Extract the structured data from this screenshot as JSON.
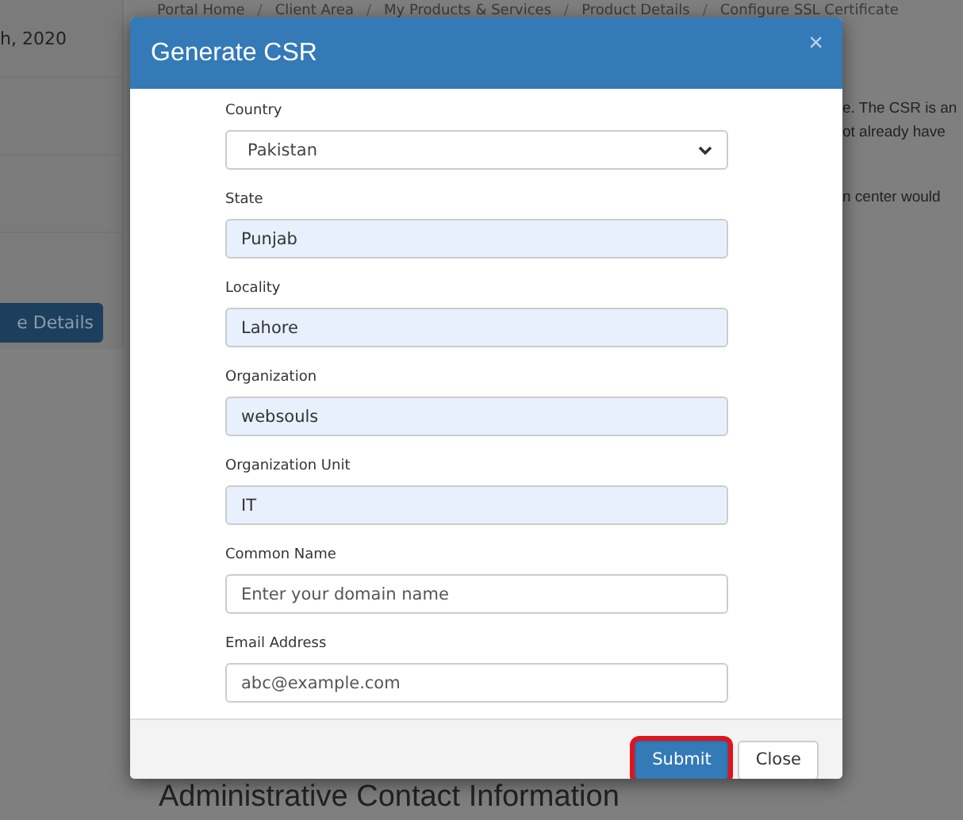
{
  "breadcrumb": [
    {
      "kind": "link",
      "text": "Portal Home"
    },
    {
      "kind": "separator",
      "text": "/"
    },
    {
      "kind": "link",
      "text": "Client Area"
    },
    {
      "kind": "separator",
      "text": "/"
    },
    {
      "kind": "link",
      "text": "My Products & Services"
    },
    {
      "kind": "separator",
      "text": "/"
    },
    {
      "kind": "link",
      "text": "Product Details"
    },
    {
      "kind": "separator",
      "text": "/"
    },
    {
      "kind": "link",
      "text": "Configure SSL Certificate"
    }
  ],
  "background": {
    "left_text": "h, 2020",
    "left_button": "e Details",
    "right_lines": [
      "e. The CSR is an",
      "ot already have",
      "n center would"
    ],
    "heading": "Administrative Contact Information"
  },
  "modal": {
    "title": "Generate CSR",
    "close": "×",
    "fields": [
      {
        "kind": "select",
        "label": "Country",
        "value": "Pakistan",
        "autofilled": false
      },
      {
        "kind": "input",
        "label": "State",
        "value": "Punjab",
        "autofilled": true
      },
      {
        "kind": "input",
        "label": "Locality",
        "value": "Lahore",
        "autofilled": true
      },
      {
        "kind": "input",
        "label": "Organization",
        "value": "websouls",
        "autofilled": true
      },
      {
        "kind": "input",
        "label": "Organization Unit",
        "value": "IT",
        "autofilled": true
      },
      {
        "kind": "input",
        "label": "Common Name",
        "placeholder": "Enter your domain name",
        "autofilled": false
      },
      {
        "kind": "input",
        "label": "Email Address",
        "placeholder": "abc@example.com",
        "autofilled": false
      }
    ],
    "buttons": [
      {
        "kind": "primary",
        "label": "Submit",
        "highlighted": true
      },
      {
        "kind": "default",
        "label": "Close",
        "highlighted": false
      }
    ]
  }
}
